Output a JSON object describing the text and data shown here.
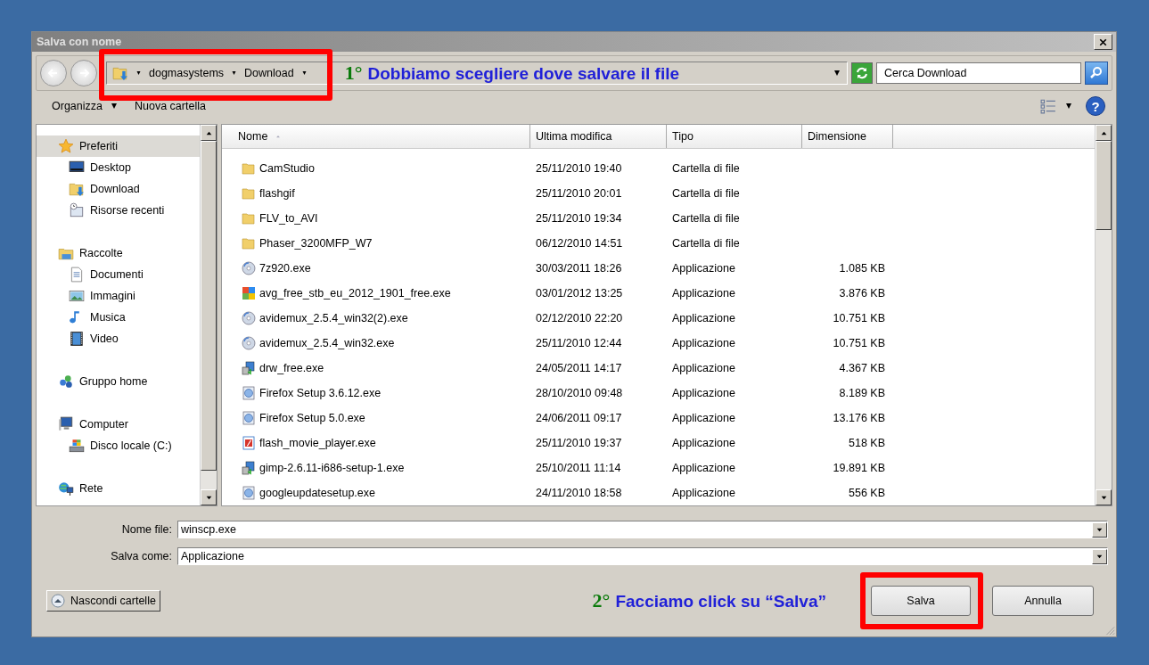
{
  "window": {
    "title": "Salva con nome"
  },
  "address": {
    "crumbs": [
      "dogmasystems",
      "Download"
    ]
  },
  "search": {
    "placeholder": "Cerca Download"
  },
  "toolbar": {
    "items": [
      "Organizza",
      "Nuova cartella"
    ],
    "help": "?"
  },
  "sidebar": {
    "items": [
      {
        "label": "Preferiti",
        "kind": "star",
        "selected": true,
        "children": [
          {
            "label": "Desktop",
            "kind": "desktop",
            "selected": false
          },
          {
            "label": "Download",
            "kind": "download",
            "selected": false
          },
          {
            "label": "Risorse recenti",
            "kind": "recent",
            "selected": false
          }
        ]
      },
      {
        "label": "Raccolte",
        "kind": "library",
        "selected": false,
        "children": [
          {
            "label": "Documenti",
            "kind": "document",
            "selected": false
          },
          {
            "label": "Immagini",
            "kind": "picture",
            "selected": false
          },
          {
            "label": "Musica",
            "kind": "music",
            "selected": false
          },
          {
            "label": "Video",
            "kind": "video",
            "selected": false
          }
        ]
      },
      {
        "label": "Gruppo home",
        "kind": "homegroup",
        "selected": false
      },
      {
        "label": "Computer",
        "kind": "computer",
        "selected": false,
        "children": [
          {
            "label": "Disco locale (C:)",
            "kind": "disk",
            "selected": false
          }
        ]
      },
      {
        "label": "Rete",
        "kind": "network",
        "selected": false
      }
    ]
  },
  "table": {
    "columns": [
      {
        "label": "Nome",
        "sorted": true
      },
      {
        "label": "Ultima modifica",
        "sorted": false
      },
      {
        "label": "Tipo",
        "sorted": false
      },
      {
        "label": "Dimensione",
        "sorted": false
      }
    ],
    "rows": [
      {
        "kind": "folder",
        "name": "CamStudio",
        "modified": "25/11/2010 19:40",
        "type": "Cartella di file"
      },
      {
        "kind": "folder",
        "name": "flashgif",
        "modified": "25/11/2010 20:01",
        "type": "Cartella di file"
      },
      {
        "kind": "folder",
        "name": "FLV_to_AVI",
        "modified": "25/11/2010 19:34",
        "type": "Cartella di file"
      },
      {
        "kind": "folder",
        "name": "Phaser_3200MFP_W7",
        "modified": "06/12/2010 14:51",
        "type": "Cartella di file"
      },
      {
        "kind": "disc",
        "name": "7z920.exe",
        "modified": "30/03/2011 18:26",
        "type": "Applicazione",
        "size": "1.085 KB"
      },
      {
        "kind": "tiles",
        "name": "avg_free_stb_eu_2012_1901_free.exe",
        "modified": "03/01/2012 13:25",
        "type": "Applicazione",
        "size": "3.876 KB"
      },
      {
        "kind": "disc",
        "name": "avidemux_2.5.4_win32(2).exe",
        "modified": "02/12/2010 22:20",
        "type": "Applicazione",
        "size": "10.751 KB"
      },
      {
        "kind": "disc",
        "name": "avidemux_2.5.4_win32.exe",
        "modified": "25/11/2010 12:44",
        "type": "Applicazione",
        "size": "10.751 KB"
      },
      {
        "kind": "installer",
        "name": "drw_free.exe",
        "modified": "24/05/2011 14:17",
        "type": "Applicazione",
        "size": "4.367 KB"
      },
      {
        "kind": "setup",
        "name": "Firefox Setup 3.6.12.exe",
        "modified": "28/10/2010 09:48",
        "type": "Applicazione",
        "size": "8.189 KB"
      },
      {
        "kind": "setup",
        "name": "Firefox Setup 5.0.exe",
        "modified": "24/06/2011 09:17",
        "type": "Applicazione",
        "size": "13.176 KB"
      },
      {
        "kind": "flash",
        "name": "flash_movie_player.exe",
        "modified": "25/11/2010 19:37",
        "type": "Applicazione",
        "size": "518 KB"
      },
      {
        "kind": "installer",
        "name": "gimp-2.6.11-i686-setup-1.exe",
        "modified": "25/10/2011 11:14",
        "type": "Applicazione",
        "size": "19.891 KB"
      },
      {
        "kind": "setup",
        "name": "googleupdatesetup.exe",
        "modified": "24/11/2010 18:58",
        "type": "Applicazione",
        "size": "556 KB"
      }
    ]
  },
  "fields": [
    {
      "label": "Nome file:",
      "value": "winscp.exe"
    },
    {
      "label": "Salva come:",
      "value": "Applicazione"
    }
  ],
  "buttons": {
    "toggle": "Nascondi cartelle",
    "save": "Salva",
    "cancel": "Annulla"
  },
  "annotations": [
    {
      "step": "1°",
      "text": "Dobbiamo scegliere dove salvare il file"
    },
    {
      "step": "2°",
      "text": "Facciamo click su “Salva”"
    }
  ]
}
